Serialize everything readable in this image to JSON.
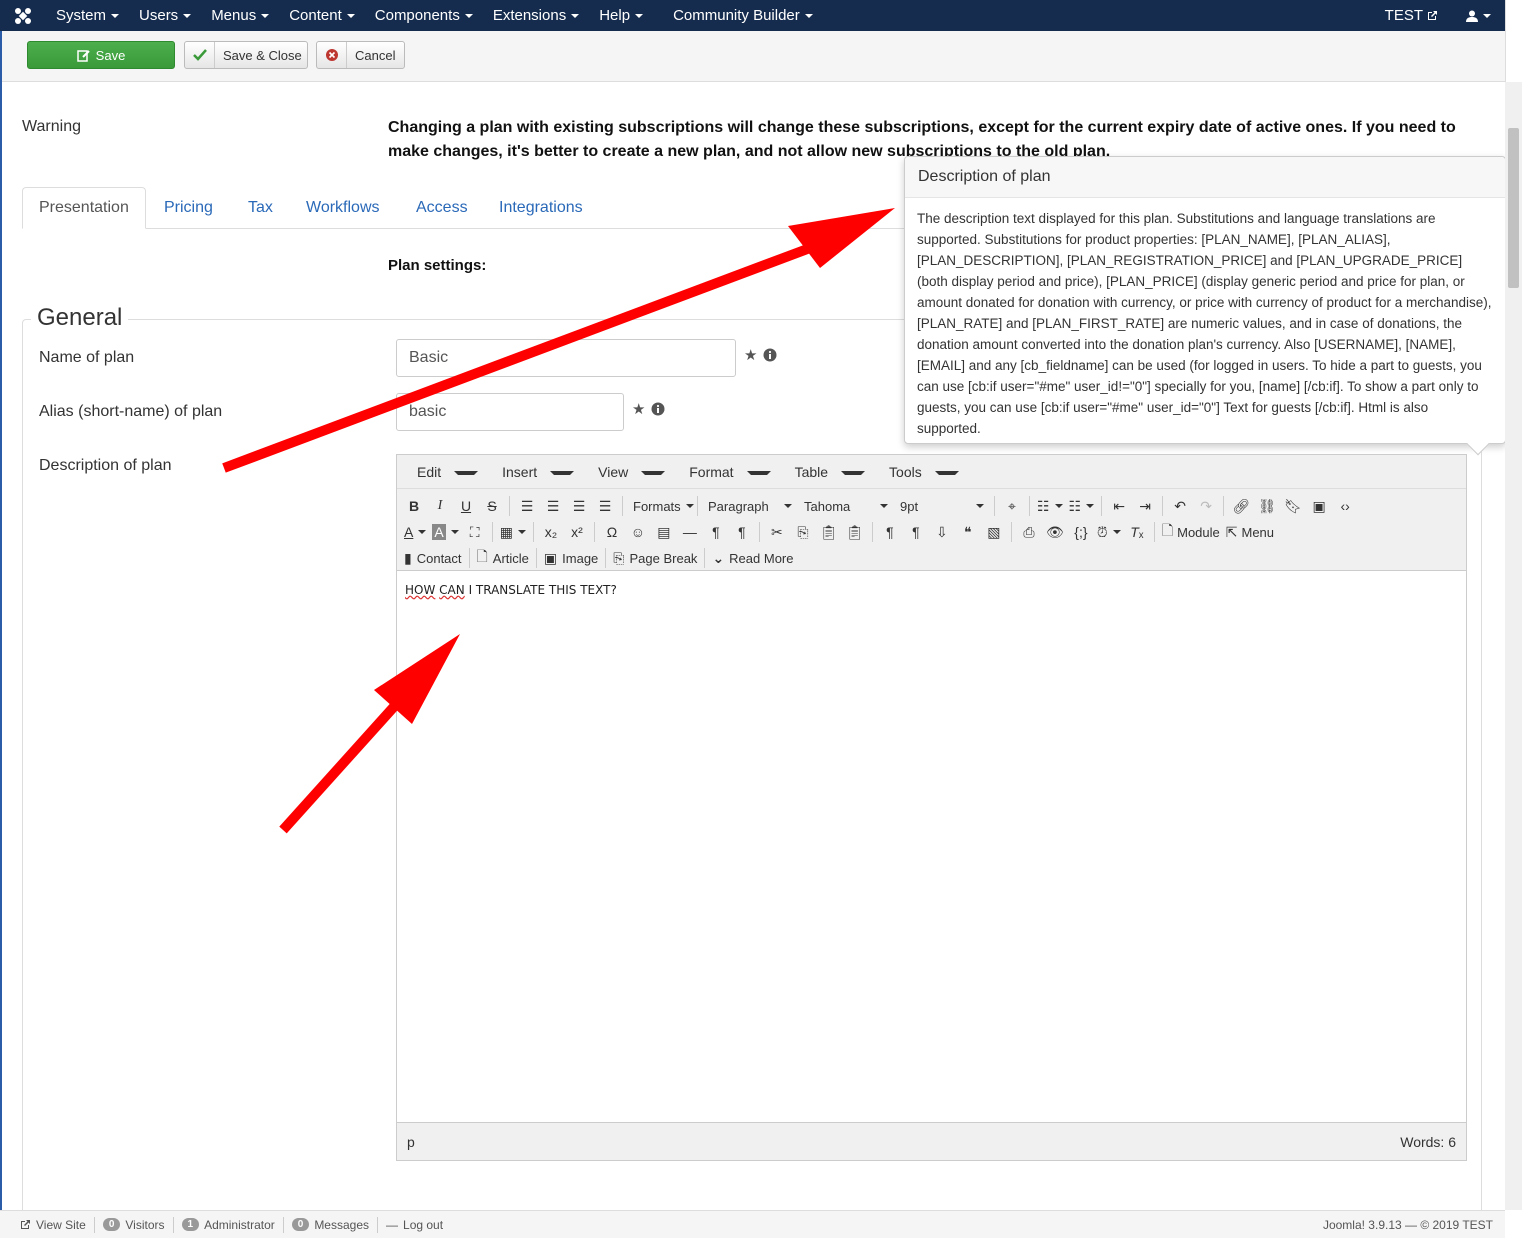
{
  "navbar": {
    "menu": [
      "System",
      "Users",
      "Menus",
      "Content",
      "Components",
      "Extensions",
      "Help",
      "Community Builder"
    ],
    "site_name": "TEST"
  },
  "toolbar": {
    "save_label": "Save",
    "save_close_label": "Save & Close",
    "cancel_label": "Cancel"
  },
  "warning": {
    "label": "Warning",
    "text": "Changing a plan with existing subscriptions will change these subscriptions, except for the current expiry date of active ones. If you need to make changes, it's better to create a new plan, and not allow new subscriptions to the old plan."
  },
  "tabs": [
    "Presentation",
    "Pricing",
    "Tax",
    "Workflows",
    "Access",
    "Integrations"
  ],
  "plan_settings_label": "Plan settings:",
  "general": {
    "legend": "General",
    "name_label": "Name of plan",
    "name_value": "Basic",
    "alias_label": "Alias (short-name) of plan",
    "alias_value": "basic",
    "description_label": "Description of plan"
  },
  "editor": {
    "menubar": [
      "Edit",
      "Insert",
      "View",
      "Format",
      "Table",
      "Tools"
    ],
    "formats_label": "Formats",
    "block_select": "Paragraph",
    "font_select": "Tahoma",
    "size_select": "9pt",
    "module_label": "Module",
    "menu_label": "Menu",
    "contact_label": "Contact",
    "article_label": "Article",
    "image_label": "Image",
    "pagebreak_label": "Page Break",
    "readmore_label": "Read More",
    "content_word1": "HOW",
    "content_word2": "CAN",
    "content_rest": " I TRANSLATE THIS TEXT?",
    "status_path": "p",
    "word_count": "Words: 6"
  },
  "popover": {
    "title": "Description of plan",
    "body": "The description text displayed for this plan. Substitutions and language translations are supported. Substitutions for product properties: [PLAN_NAME], [PLAN_ALIAS], [PLAN_DESCRIPTION], [PLAN_REGISTRATION_PRICE] and [PLAN_UPGRADE_PRICE] (both display period and price), [PLAN_PRICE] (display generic period and price for plan, or amount donated for donation with currency, or price with currency of product for a merchandise), [PLAN_RATE] and [PLAN_FIRST_RATE] are numeric values, and in case of donations, the donation amount converted into the donation plan's currency. Also [USERNAME], [NAME], [EMAIL] and any [cb_fieldname] can be used (for logged in users. To hide a part to guests, you can use [cb:if user=\"#me\" user_id!=\"0\"] specially for you, [name] [/cb:if]. To show a part only to guests, you can use [cb:if user=\"#me\" user_id=\"0\"] Text for guests [/cb:if]. Html is also supported."
  },
  "statusbar": {
    "view_site": "View Site",
    "visitors_count": "0",
    "visitors_label": "Visitors",
    "admin_count": "1",
    "admin_label": "Administrator",
    "messages_count": "0",
    "messages_label": "Messages",
    "logout_label": "Log out",
    "version": "Joomla! 3.9.13 — © 2019 TEST"
  },
  "colors": {
    "navbar": "#162c4e",
    "save_button": "#3fa33f",
    "link": "#2a69b8",
    "annotation_arrow": "#ff0000"
  }
}
